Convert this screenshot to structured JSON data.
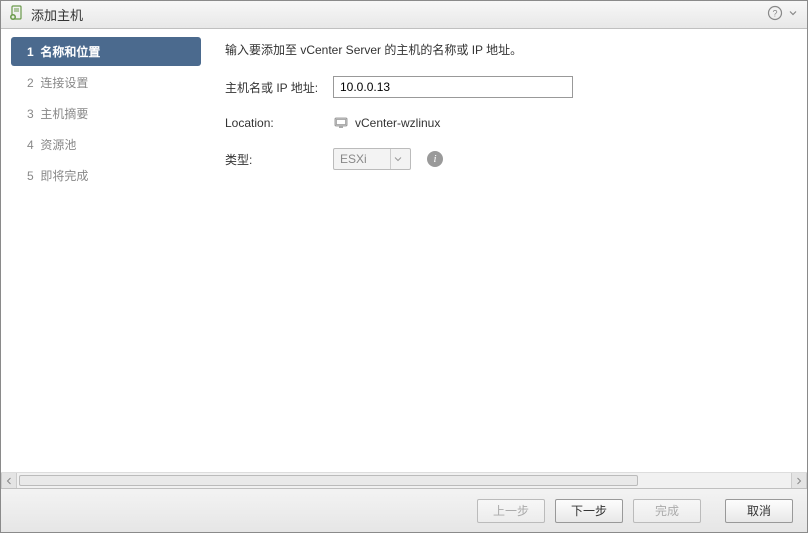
{
  "title": "添加主机",
  "steps": [
    {
      "num": "1",
      "label": "名称和位置",
      "active": true
    },
    {
      "num": "2",
      "label": "连接设置",
      "active": false
    },
    {
      "num": "3",
      "label": "主机摘要",
      "active": false
    },
    {
      "num": "4",
      "label": "资源池",
      "active": false
    },
    {
      "num": "5",
      "label": "即将完成",
      "active": false
    }
  ],
  "panel": {
    "instruction": "输入要添加至 vCenter Server 的主机的名称或 IP 地址。",
    "host_label": "主机名或 IP 地址:",
    "host_value": "10.0.0.13",
    "location_label": "Location:",
    "location_value": "vCenter-wzlinux",
    "type_label": "类型:",
    "type_value": "ESXi"
  },
  "footer": {
    "back": "上一步",
    "next": "下一步",
    "finish": "完成",
    "cancel": "取消"
  }
}
